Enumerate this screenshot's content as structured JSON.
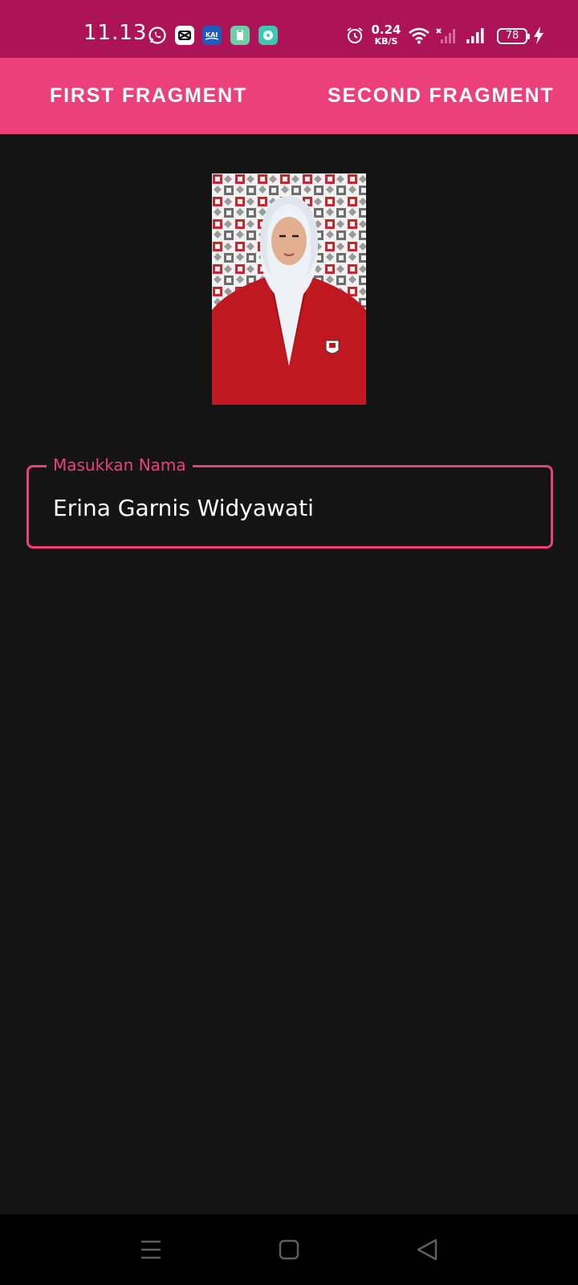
{
  "status_bar": {
    "time": "11.13",
    "network_speed_value": "0.24",
    "network_speed_unit": "KB/S",
    "battery_level": "78",
    "icons": [
      "whatsapp-icon",
      "capcut-icon",
      "kai-access-icon",
      "app-icon",
      "chat-icon",
      "alarm-icon",
      "wifi-icon",
      "signal-no-service-icon",
      "signal-icon",
      "battery-icon",
      "charging-icon"
    ],
    "background_color": "#ad1457"
  },
  "tabs": [
    {
      "label": "FIRST FRAGMENT"
    },
    {
      "label": "SECOND FRAGMENT"
    }
  ],
  "form": {
    "name_label": "Masukkan Nama",
    "name_value": "Erina Garnis Widyawati"
  },
  "nav_bar": {
    "icons": [
      "recents-menu-icon",
      "home-icon",
      "back-icon"
    ]
  },
  "colors": {
    "accent": "#ec407a",
    "status_bar": "#ad1457",
    "background": "#141414",
    "nav_bar": "#000000"
  }
}
